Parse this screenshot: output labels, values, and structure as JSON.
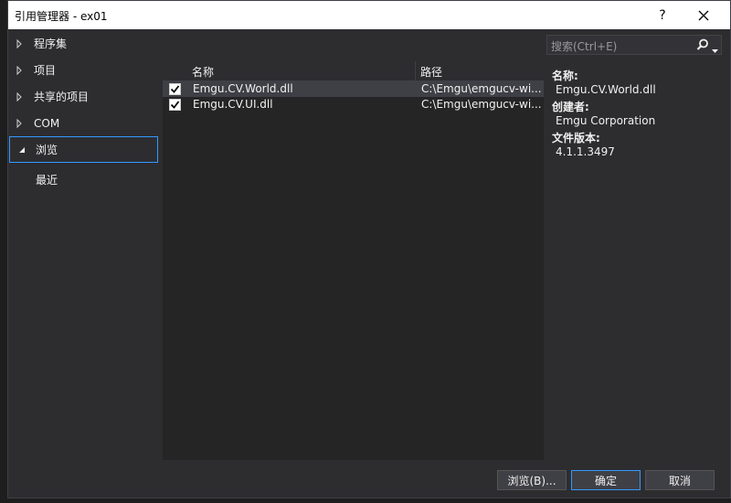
{
  "window": {
    "title": "引用管理器 - ex01",
    "help": "?",
    "close": "✕"
  },
  "nav": {
    "items": [
      {
        "label": "程序集",
        "expanded": false
      },
      {
        "label": "项目",
        "expanded": false
      },
      {
        "label": "共享的项目",
        "expanded": false
      },
      {
        "label": "COM",
        "expanded": false
      },
      {
        "label": "浏览",
        "expanded": true
      }
    ],
    "sub_items": [
      {
        "label": "最近"
      }
    ]
  },
  "list": {
    "columns": [
      "名称",
      "路径"
    ],
    "rows": [
      {
        "checked": true,
        "name": "Emgu.CV.World.dll",
        "path": "C:\\Emgu\\emgucv-wi..."
      },
      {
        "checked": true,
        "name": "Emgu.CV.UI.dll",
        "path": "C:\\Emgu\\emgucv-wi..."
      }
    ]
  },
  "search": {
    "placeholder": "搜索(Ctrl+E)"
  },
  "details": {
    "name_label": "名称:",
    "name_value": "Emgu.CV.World.dll",
    "creator_label": "创建者:",
    "creator_value": "Emgu Corporation",
    "version_label": "文件版本:",
    "version_value": "4.1.1.3497"
  },
  "buttons": {
    "browse": "浏览(B)...",
    "ok": "确定",
    "cancel": "取消"
  },
  "colors": {
    "accent": "#3399ff",
    "dialog_bg": "#2d2d30",
    "list_bg": "#252526"
  }
}
